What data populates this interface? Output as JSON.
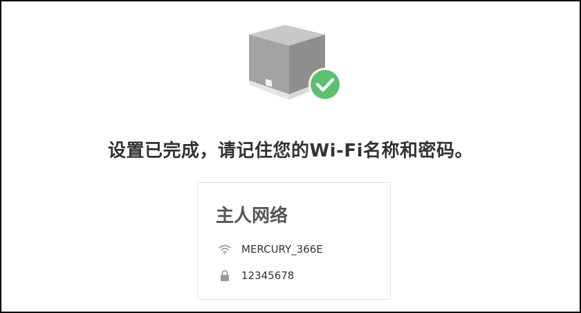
{
  "page": {
    "title": "设置已完成，请记住您的Wi-Fi名称和密码。"
  },
  "illustration": {
    "device_icon": "router-cube-icon",
    "status_icon": "checkmark-circle-icon",
    "colors": {
      "device": "#9b9b9b",
      "check_badge": "#5cc06e"
    }
  },
  "card": {
    "title": "主人网络",
    "ssid_icon": "wifi-icon",
    "ssid": "MERCURY_366E",
    "password_icon": "lock-icon",
    "password": "12345678"
  }
}
